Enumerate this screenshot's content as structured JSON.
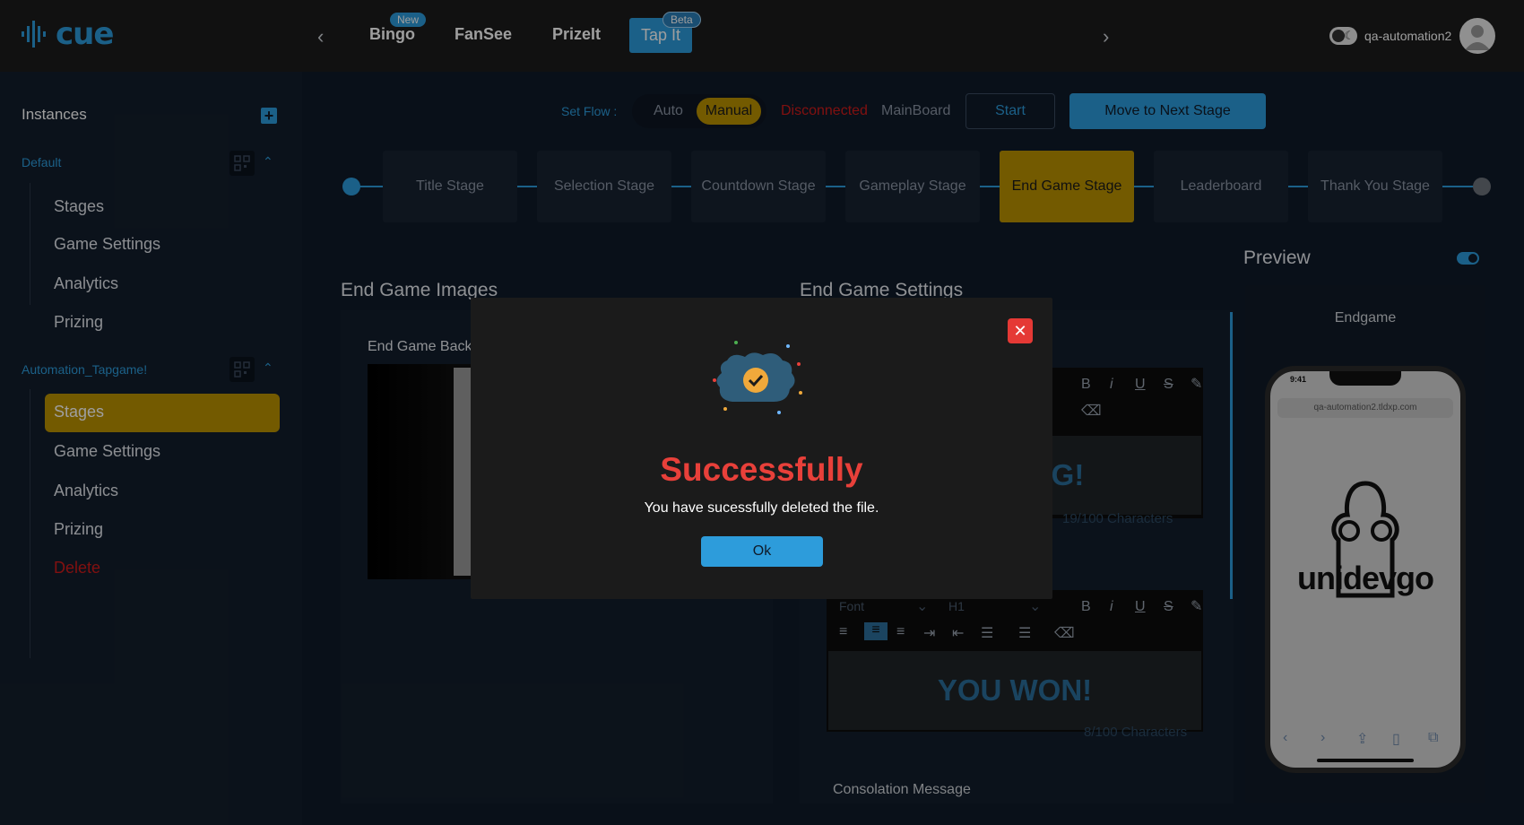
{
  "brand": {
    "logo_text": "cue",
    "accent": "#2d9cdb",
    "gold": "#ba9100"
  },
  "topnav": {
    "items": [
      {
        "label": "Bingo",
        "badge": "New"
      },
      {
        "label": "FanSee"
      },
      {
        "label": "PrizeIt"
      },
      {
        "label": "Tap It",
        "badge": "Beta"
      }
    ],
    "username": "qa-automation2"
  },
  "sidebar": {
    "heading": "Instances",
    "groups": [
      {
        "name": "Default",
        "items": [
          "Stages",
          "Game Settings",
          "Analytics",
          "Prizing"
        ]
      },
      {
        "name": "Automation_Tapgame!",
        "items": [
          "Stages",
          "Game Settings",
          "Analytics",
          "Prizing",
          "Delete"
        ]
      }
    ]
  },
  "flow": {
    "set_flow_label": "Set Flow :",
    "auto": "Auto",
    "manual": "Manual",
    "status": "Disconnected",
    "board": "MainBoard",
    "start": "Start",
    "next": "Move to Next Stage"
  },
  "stages": [
    "Title Stage",
    "Selection Stage",
    "Countdown Stage",
    "Gameplay Stage",
    "End Game Stage",
    "Leaderboard",
    "Thank You Stage"
  ],
  "active_stage": "End Game Stage",
  "images_section": {
    "title": "End Game Images",
    "label": "End Game Back"
  },
  "settings_section": {
    "title": "End Game Settings",
    "editor1": {
      "content": "PLAYING!",
      "count": "19/100 Characters"
    },
    "editor2": {
      "font": "Font",
      "heading": "H1",
      "content": "YOU WON!",
      "count": "8/100 Characters"
    },
    "consolation": "Consolation Message"
  },
  "preview": {
    "title": "Preview",
    "label": "Endgame",
    "phone_time": "9:41",
    "phone_url": "qa-automation2.tldxp.com",
    "phone_brand": "unidevgo"
  },
  "modal": {
    "title": "Successfully",
    "message": "You have sucessfully deleted the file.",
    "ok": "Ok"
  }
}
